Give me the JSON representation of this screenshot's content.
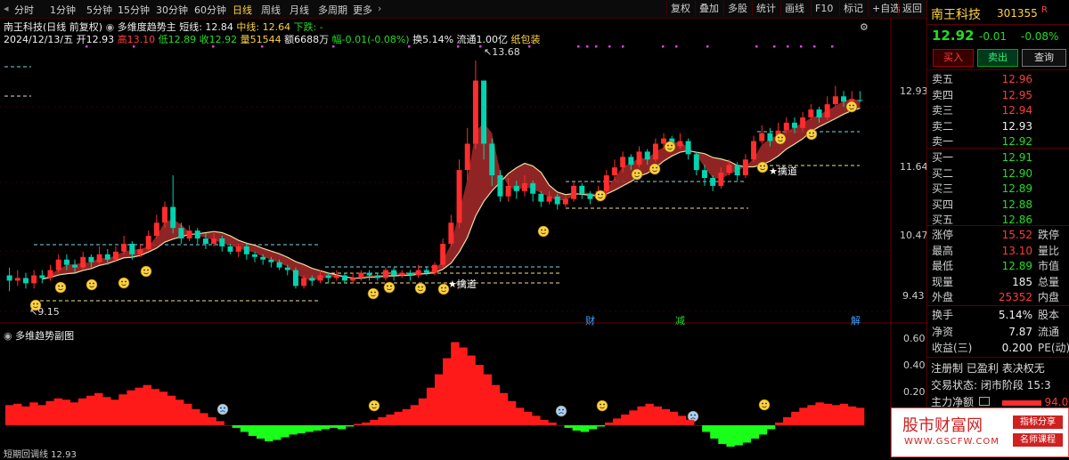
{
  "toolbar": {
    "periods": [
      "分时",
      "1分钟",
      "5分钟",
      "15分钟",
      "30分钟",
      "60分钟",
      "日线",
      "周线",
      "月线",
      "多周期",
      "更多"
    ],
    "active_period": "日线",
    "right_buttons": [
      "复权",
      "叠加",
      "多股",
      "统计",
      "画线",
      "F10",
      "标记",
      "+自选",
      "返回"
    ]
  },
  "chart_header": {
    "title": "南王科技(日线 前复权)",
    "indicator": "多维度趋势主",
    "short_label": "短线: 12.84",
    "mid_label": "中线: 12.64",
    "down_label": "下跌: -",
    "ohlc_line": {
      "date": "2024/12/13/五",
      "open": "开12.93",
      "high": "高13.10",
      "low": "低12.89",
      "close": "收12.92",
      "volume": "量51544",
      "amount": "额6688万",
      "change": "幅-0.01(-0.08%)",
      "turnover": "换5.14%",
      "float": "流通1.00亿",
      "pattern": "纸包装"
    }
  },
  "price_axis": [
    "12.93",
    "11.64",
    "10.47",
    "9.43"
  ],
  "annotations": {
    "high_price": "13.68",
    "low_price": "9.15",
    "pick_label": "擒道"
  },
  "event_markers": [
    "财",
    "减",
    "解"
  ],
  "sub_chart": {
    "title": "多维趋势副图",
    "axis": [
      "0.60",
      "0.40",
      "0.20"
    ],
    "bottom_caption": "短期回调线  12.93"
  },
  "right_panel": {
    "name": "南王科技",
    "code": "301355",
    "flag": "R",
    "price": "12.92",
    "change": "-0.01",
    "change_pct": "-0.08%",
    "buttons": [
      "买入",
      "卖出",
      "查询"
    ],
    "asks": [
      {
        "label": "卖五",
        "price": "12.96",
        "color": "#ff3b3b"
      },
      {
        "label": "卖四",
        "price": "12.95",
        "color": "#ff3b3b"
      },
      {
        "label": "卖三",
        "price": "12.94",
        "color": "#ff3b3b"
      },
      {
        "label": "卖二",
        "price": "12.93",
        "color": "#f0f0f0"
      },
      {
        "label": "卖一",
        "price": "12.92",
        "color": "#22dd22"
      }
    ],
    "bids": [
      {
        "label": "买一",
        "price": "12.91",
        "color": "#22dd22"
      },
      {
        "label": "买二",
        "price": "12.90",
        "color": "#22dd22"
      },
      {
        "label": "买三",
        "price": "12.89",
        "color": "#22dd22"
      },
      {
        "label": "买四",
        "price": "12.88",
        "color": "#22dd22"
      },
      {
        "label": "买五",
        "price": "12.86",
        "color": "#22dd22"
      }
    ],
    "stats": [
      {
        "label": "涨停",
        "value": "15.52",
        "color": "#ff3b3b",
        "label2": "跌停"
      },
      {
        "label": "最高",
        "value": "13.10",
        "color": "#ff3b3b",
        "label2": "量比"
      },
      {
        "label": "最低",
        "value": "12.89",
        "color": "#22dd22",
        "label2": "市值"
      },
      {
        "label": "现量",
        "value": "185",
        "color": "#f0f0f0",
        "label2": "总量"
      },
      {
        "label": "外盘",
        "value": "25352",
        "color": "#ff3b3b",
        "label2": "内盘"
      }
    ],
    "stats2": [
      {
        "label": "换手",
        "value": "5.14%",
        "color": "#f0f0f0",
        "label2": "股本"
      },
      {
        "label": "净资",
        "value": "7.87",
        "color": "#f0f0f0",
        "label2": "流通"
      },
      {
        "label": "收益(三)",
        "value": "0.200",
        "color": "#f0f0f0",
        "label2": "PE(动)"
      }
    ],
    "info": [
      "注册制",
      "已盈利",
      "表决权无"
    ],
    "trade_state_label": "交易状态:",
    "trade_state_value": "闭市阶段",
    "trade_time": "15:3",
    "main_flow_label": "主力净额",
    "main_flow_value": "94.0"
  },
  "watermark": {
    "brand": "股市财富网",
    "url": "WWW.GSCFW.COM",
    "tag1": "指标分享",
    "tag2": "名师课程"
  },
  "colors": {
    "up": "#ff2d2d",
    "down": "#00d4b0",
    "ribbon": "#a02828",
    "accent": "#ffd23f",
    "panel_border": "#5a0000"
  },
  "chart_data": {
    "type": "candlestick",
    "candles": [
      [
        9.6,
        9.5,
        9.75,
        9.3
      ],
      [
        9.5,
        9.55,
        9.7,
        9.4
      ],
      [
        9.55,
        9.45,
        9.65,
        9.35
      ],
      [
        9.45,
        9.6,
        9.7,
        9.35
      ],
      [
        9.6,
        9.55,
        9.7,
        9.45
      ],
      [
        9.55,
        9.7,
        9.8,
        9.5
      ],
      [
        9.7,
        9.9,
        10.0,
        9.65
      ],
      [
        9.9,
        9.8,
        10.0,
        9.7
      ],
      [
        9.8,
        9.75,
        9.9,
        9.65
      ],
      [
        9.75,
        9.95,
        10.05,
        9.7
      ],
      [
        9.95,
        9.85,
        10.0,
        9.75
      ],
      [
        9.85,
        10.0,
        10.15,
        9.8
      ],
      [
        10.0,
        9.9,
        10.1,
        9.8
      ],
      [
        9.9,
        10.05,
        10.15,
        9.85
      ],
      [
        10.05,
        10.2,
        10.35,
        10.0
      ],
      [
        10.2,
        10.0,
        10.25,
        9.9
      ],
      [
        10.0,
        10.1,
        10.2,
        9.95
      ],
      [
        10.1,
        10.35,
        10.45,
        10.05
      ],
      [
        10.35,
        10.6,
        10.75,
        10.3
      ],
      [
        10.6,
        10.9,
        11.0,
        10.5
      ],
      [
        10.9,
        10.5,
        11.5,
        10.4
      ],
      [
        10.5,
        10.3,
        10.6,
        10.2
      ],
      [
        10.3,
        10.45,
        10.55,
        10.25
      ],
      [
        10.45,
        10.3,
        10.5,
        10.2
      ],
      [
        10.3,
        10.2,
        10.4,
        10.1
      ],
      [
        10.2,
        10.3,
        10.4,
        10.15
      ],
      [
        10.3,
        10.15,
        10.35,
        10.05
      ],
      [
        10.15,
        10.05,
        10.2,
        10.0
      ],
      [
        10.05,
        10.15,
        10.2,
        9.95
      ],
      [
        10.15,
        10.0,
        10.2,
        9.9
      ],
      [
        10.0,
        9.95,
        10.05,
        9.85
      ],
      [
        9.95,
        9.9,
        10.0,
        9.8
      ],
      [
        9.9,
        9.85,
        9.95,
        9.75
      ],
      [
        9.85,
        9.75,
        9.9,
        9.7
      ],
      [
        9.75,
        9.7,
        9.8,
        9.6
      ],
      [
        9.7,
        9.4,
        9.75,
        9.35
      ],
      [
        9.4,
        9.55,
        9.6,
        9.35
      ],
      [
        9.55,
        9.5,
        9.6,
        9.4
      ],
      [
        9.5,
        9.6,
        9.7,
        9.45
      ],
      [
        9.6,
        9.55,
        9.65,
        9.45
      ],
      [
        9.55,
        9.6,
        9.7,
        9.5
      ],
      [
        9.6,
        9.5,
        9.65,
        9.45
      ],
      [
        9.5,
        9.55,
        9.65,
        9.45
      ],
      [
        9.55,
        9.65,
        9.7,
        9.5
      ],
      [
        9.65,
        9.6,
        9.7,
        9.5
      ],
      [
        9.6,
        9.55,
        9.65,
        9.5
      ],
      [
        9.55,
        9.7,
        9.75,
        9.5
      ],
      [
        9.7,
        9.6,
        9.75,
        9.5
      ],
      [
        9.6,
        9.65,
        9.7,
        9.55
      ],
      [
        9.65,
        9.6,
        9.7,
        9.5
      ],
      [
        9.6,
        9.7,
        9.8,
        9.55
      ],
      [
        9.7,
        9.65,
        9.75,
        9.6
      ],
      [
        9.65,
        9.8,
        9.85,
        9.6
      ],
      [
        9.8,
        10.2,
        10.3,
        9.75
      ],
      [
        10.2,
        10.6,
        10.75,
        10.15
      ],
      [
        10.6,
        11.6,
        11.8,
        10.5
      ],
      [
        11.6,
        12.1,
        12.4,
        11.4
      ],
      [
        12.1,
        13.3,
        13.68,
        12.0
      ],
      [
        13.3,
        12.1,
        12.5,
        11.8
      ],
      [
        12.1,
        11.5,
        12.2,
        11.3
      ],
      [
        11.5,
        11.1,
        11.6,
        11.0
      ],
      [
        11.1,
        11.3,
        11.45,
        11.0
      ],
      [
        11.3,
        11.2,
        11.4,
        11.05
      ],
      [
        11.2,
        11.35,
        11.5,
        11.1
      ],
      [
        11.35,
        11.15,
        11.4,
        11.0
      ],
      [
        11.15,
        11.0,
        11.2,
        10.9
      ],
      [
        11.0,
        11.1,
        11.2,
        10.95
      ],
      [
        11.1,
        10.95,
        11.15,
        10.85
      ],
      [
        10.95,
        11.05,
        11.1,
        10.9
      ],
      [
        11.05,
        11.3,
        11.4,
        11.0
      ],
      [
        11.3,
        11.15,
        11.35,
        11.05
      ],
      [
        11.15,
        11.05,
        11.2,
        10.95
      ],
      [
        11.05,
        11.2,
        11.3,
        11.0
      ],
      [
        11.2,
        11.5,
        11.6,
        11.1
      ],
      [
        11.5,
        11.65,
        11.8,
        11.4
      ],
      [
        11.65,
        11.85,
        11.95,
        11.55
      ],
      [
        11.85,
        11.7,
        11.9,
        11.6
      ],
      [
        11.7,
        11.95,
        12.05,
        11.65
      ],
      [
        11.95,
        11.8,
        12.0,
        11.7
      ],
      [
        11.8,
        12.1,
        12.2,
        11.75
      ],
      [
        12.1,
        12.2,
        12.3,
        12.0
      ],
      [
        12.2,
        12.05,
        12.25,
        11.95
      ],
      [
        12.05,
        12.15,
        12.3,
        12.0
      ],
      [
        12.15,
        11.9,
        12.2,
        11.8
      ],
      [
        11.9,
        11.6,
        11.95,
        11.5
      ],
      [
        11.6,
        11.45,
        11.7,
        11.3
      ],
      [
        11.45,
        11.3,
        11.5,
        11.2
      ],
      [
        11.3,
        11.55,
        11.65,
        11.25
      ],
      [
        11.55,
        11.7,
        11.8,
        11.5
      ],
      [
        11.7,
        11.5,
        11.75,
        11.4
      ],
      [
        11.5,
        11.8,
        11.9,
        11.45
      ],
      [
        11.8,
        12.15,
        12.25,
        11.75
      ],
      [
        12.15,
        12.3,
        12.45,
        12.1
      ],
      [
        12.3,
        12.15,
        12.4,
        12.05
      ],
      [
        12.15,
        12.35,
        12.5,
        12.1
      ],
      [
        12.35,
        12.5,
        12.6,
        12.3
      ],
      [
        12.5,
        12.4,
        12.6,
        12.3
      ],
      [
        12.4,
        12.6,
        12.7,
        12.35
      ],
      [
        12.6,
        12.75,
        12.85,
        12.55
      ],
      [
        12.75,
        12.6,
        12.8,
        12.5
      ],
      [
        12.6,
        12.85,
        13.0,
        12.55
      ],
      [
        12.85,
        13.0,
        13.2,
        12.8
      ],
      [
        13.0,
        12.9,
        13.1,
        12.8
      ],
      [
        12.9,
        12.95,
        13.1,
        12.85
      ],
      [
        12.93,
        12.92,
        13.1,
        12.89
      ]
    ],
    "histogram": [
      0.15,
      0.16,
      0.14,
      0.17,
      0.15,
      0.18,
      0.2,
      0.19,
      0.17,
      0.2,
      0.22,
      0.24,
      0.21,
      0.19,
      0.23,
      0.26,
      0.28,
      0.3,
      0.27,
      0.25,
      0.22,
      0.19,
      0.16,
      0.12,
      0.09,
      0.06,
      0.03,
      0.0,
      -0.02,
      -0.05,
      -0.08,
      -0.1,
      -0.12,
      -0.11,
      -0.09,
      -0.07,
      -0.06,
      -0.05,
      -0.04,
      -0.03,
      -0.02,
      -0.03,
      -0.01,
      0.01,
      0.02,
      0.04,
      0.06,
      0.08,
      0.1,
      0.12,
      0.15,
      0.2,
      0.28,
      0.38,
      0.5,
      0.62,
      0.58,
      0.52,
      0.45,
      0.38,
      0.3,
      0.24,
      0.18,
      0.13,
      0.1,
      0.07,
      0.04,
      0.02,
      0.0,
      -0.02,
      -0.04,
      -0.05,
      -0.03,
      -0.01,
      0.02,
      0.05,
      0.08,
      0.11,
      0.14,
      0.16,
      0.14,
      0.12,
      0.1,
      0.07,
      0.04,
      0.0,
      -0.05,
      -0.1,
      -0.14,
      -0.16,
      -0.15,
      -0.13,
      -0.1,
      -0.07,
      -0.03,
      0.02,
      0.06,
      0.1,
      0.13,
      0.15,
      0.17,
      0.16,
      0.15,
      0.16,
      0.14,
      0.13
    ],
    "ylim": [
      9.0,
      13.9
    ],
    "histogram_ylim": [
      -0.2,
      0.65
    ]
  }
}
